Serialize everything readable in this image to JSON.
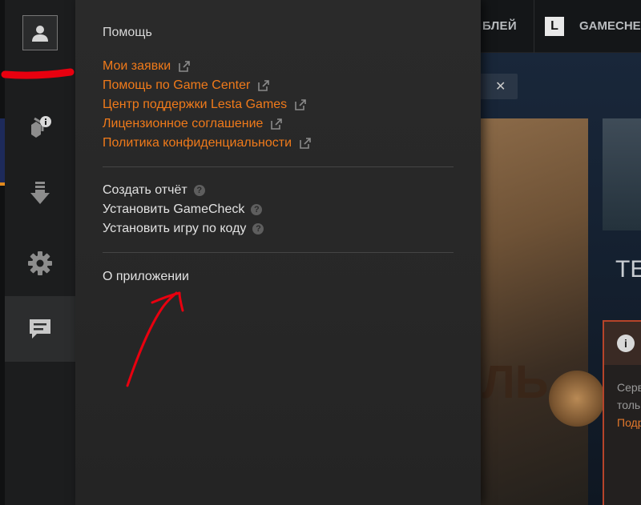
{
  "top_nav": {
    "item_partial_1": "БЛЕЙ",
    "logo_letter": "L",
    "item_partial_2": "GAMECHE"
  },
  "background": {
    "banner_letters": "ЛЬ",
    "section_title_partial": "ТЕ",
    "notice_line_1": "Серв",
    "notice_line_2": "толь",
    "notice_link": "Подр"
  },
  "sidebar": {
    "items": [
      {
        "icon": "user-icon"
      },
      {
        "icon": "notification-icon"
      },
      {
        "icon": "download-icon"
      },
      {
        "icon": "gear-icon"
      },
      {
        "icon": "chat-icon",
        "active": true
      }
    ]
  },
  "help_menu": {
    "title": "Помощь",
    "links": [
      {
        "label": "Мои заявки"
      },
      {
        "label": "Помощь по Game Center"
      },
      {
        "label": "Центр поддержки Lesta Games"
      },
      {
        "label": "Лицензионное соглашение"
      },
      {
        "label": "Политика конфиденциальности"
      }
    ],
    "actions": [
      {
        "label": "Создать отчёт"
      },
      {
        "label": "Установить GameCheck"
      },
      {
        "label": "Установить игру по коду"
      }
    ],
    "about_label": "О приложении",
    "help_marker": "?"
  },
  "colors": {
    "link": "#f07a1a",
    "menu_bg": "#2a2a2a",
    "sidebar_bg": "#1c1d1e",
    "annotation_red": "#e8000f"
  }
}
